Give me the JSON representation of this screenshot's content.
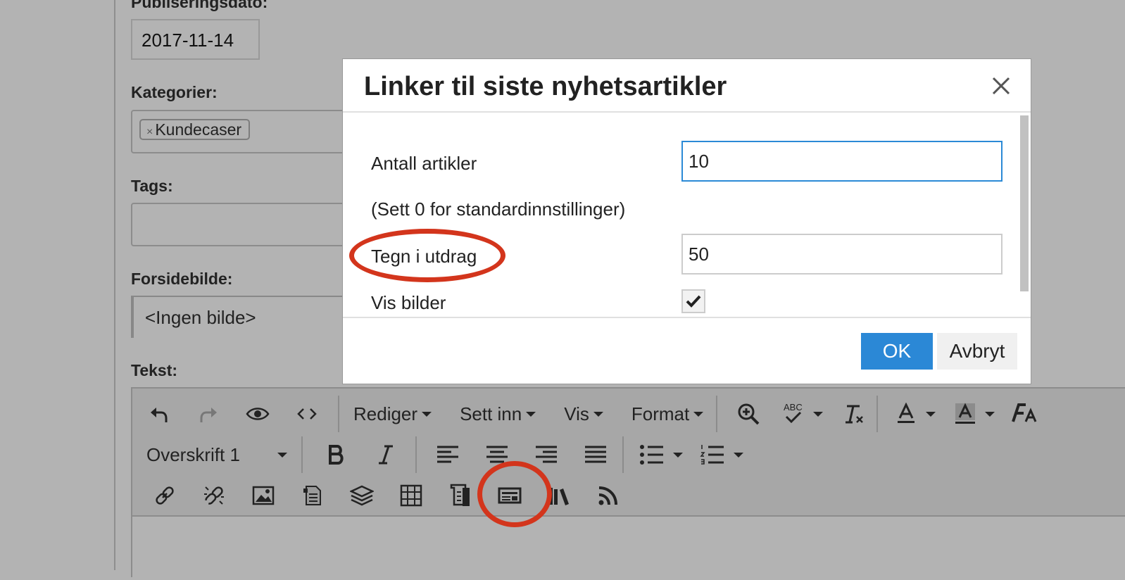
{
  "form": {
    "publish_date_label": "Publiseringsdato:",
    "publish_date_value": "2017-11-14",
    "categories_label": "Kategorier:",
    "category_chip": "Kundecaser",
    "category_chip_remove": "×",
    "tags_label": "Tags:",
    "frontpage_image_label": "Forsidebilde:",
    "frontpage_image_value": "<Ingen bilde>",
    "text_label": "Tekst:"
  },
  "toolbar": {
    "menus": [
      "Rediger",
      "Sett inn",
      "Vis",
      "Format"
    ],
    "block_format": "Overskrift 1",
    "spellcheck_glyph": "ABC"
  },
  "dialog": {
    "title": "Linker til siste nyhetsartikler",
    "close_glyph": "×",
    "article_count_label": "Antall artikler",
    "article_count_value": "10",
    "hint": "(Sett 0 for standardinnstillinger)",
    "excerpt_chars_label": "Tegn i utdrag",
    "excerpt_chars_value": "50",
    "show_images_label": "Vis bilder",
    "show_images_checked": true,
    "ok_label": "OK",
    "cancel_label": "Avbryt"
  },
  "colors": {
    "annotation_red": "#d3351c",
    "ok_blue": "#2b88d6",
    "overlay_gray": "#b3b3b3"
  }
}
